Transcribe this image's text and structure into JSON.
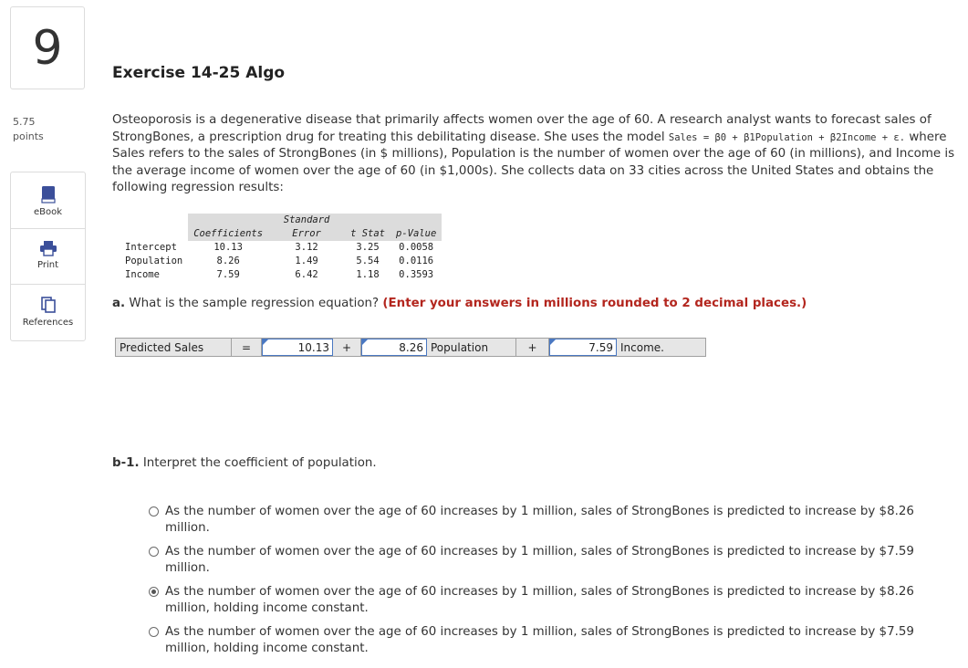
{
  "question": {
    "number": "9",
    "points_value": "5.75",
    "points_label": "points"
  },
  "tools": [
    {
      "label": "eBook",
      "icon": "book-icon"
    },
    {
      "label": "Print",
      "icon": "printer-icon"
    },
    {
      "label": "References",
      "icon": "references-icon"
    }
  ],
  "title": "Exercise 14-25 Algo",
  "prompt": {
    "part1": "Osteoporosis is a degenerative disease that primarily affects women over the age of 60. A research analyst wants to forecast sales of StrongBones, a prescription drug for treating this debilitating disease. She uses the model ",
    "model": "Sales = β0 + β1Population + β2Income + ε.",
    "part2": " where Sales refers to the sales of StrongBones (in $ millions), Population is the number of women over the age of 60 (in millions), and Income is the average income of women over the age of 60 (in $1,000s). She collects data on 33 cities across the United States and obtains the following regression results:"
  },
  "regression": {
    "headers": [
      "",
      "Coefficients",
      "Standard Error",
      "t Stat",
      "p-Value"
    ],
    "rows": [
      {
        "name": "Intercept",
        "coef": "10.13",
        "se": "3.12",
        "t": "3.25",
        "p": "0.0058"
      },
      {
        "name": "Population",
        "coef": "8.26",
        "se": "1.49",
        "t": "5.54",
        "p": "0.0116"
      },
      {
        "name": "Income",
        "coef": "7.59",
        "se": "6.42",
        "t": "1.18",
        "p": "0.3593"
      }
    ]
  },
  "part_a": {
    "label": "a.",
    "text": " What is the sample regression equation? ",
    "instruction": "(Enter your answers in millions rounded to 2 decimal places.)"
  },
  "equation": {
    "lhs": "Predicted Sales",
    "equals": "=",
    "intercept": "10.13",
    "plus1": "+",
    "coef_pop": "8.26",
    "pop_label": "Population",
    "plus2": "+",
    "coef_inc": "7.59",
    "inc_label": "Income."
  },
  "part_b1": {
    "label": "b-1.",
    "text": " Interpret the coefficient of population."
  },
  "options": [
    {
      "text": "As the number of women over the age of 60 increases by 1 million, sales of StrongBones is predicted to increase by $8.26 million.",
      "selected": false
    },
    {
      "text": "As the number of women over the age of 60 increases by 1 million, sales of StrongBones is predicted to increase by $7.59 million.",
      "selected": false
    },
    {
      "text": "As the number of women over the age of 60 increases by 1 million, sales of StrongBones is predicted to increase by $8.26 million, holding income constant.",
      "selected": true
    },
    {
      "text": "As the number of women over the age of 60 increases by 1 million, sales of StrongBones is predicted to increase by $7.59 million, holding income constant.",
      "selected": false
    }
  ],
  "colors": {
    "accent_blue": "#4a78c2",
    "instruction_red": "#b3261e",
    "book_icon": "#3b4f9a"
  }
}
